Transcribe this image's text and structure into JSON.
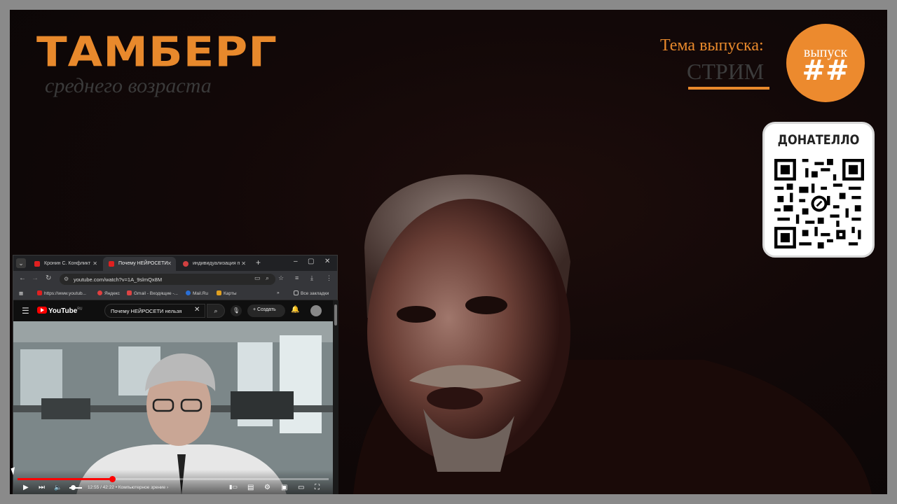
{
  "brand": {
    "title": "ТАМБЕРГ",
    "subtitle": "среднего возраста",
    "accent": "#e8892c"
  },
  "topic": {
    "label": "Тема выпуска:",
    "value": "СТРИМ"
  },
  "episode": {
    "label": "выпуск",
    "number": "##"
  },
  "donation": {
    "title": "ДОНАТЕЛЛО",
    "icon": "qr-code-icon"
  },
  "browser": {
    "tabs": [
      {
        "label": "Кронин С. Конфликт",
        "active": false
      },
      {
        "label": "Почему НЕЙРОСЕТИ",
        "active": true
      },
      {
        "label": "индивидуализация п",
        "active": false
      }
    ],
    "url": "youtube.com/watch?v=1A_9slmQx8M",
    "bookmarks": [
      "https://www.youtub...",
      "Яндекс",
      "Gmail - Входящие -...",
      "Mail.Ru",
      "Карты"
    ],
    "bookmarks_folder": "Все закладки"
  },
  "youtube": {
    "logo": "YouTube",
    "region": "RU",
    "search_value": "Почему НЕЙРОСЕТИ нельзя",
    "create_label": "Создать",
    "time": "12:55 / 42:22",
    "chapter": "Компьютерное зрение",
    "progress_fraction": 0.305
  }
}
